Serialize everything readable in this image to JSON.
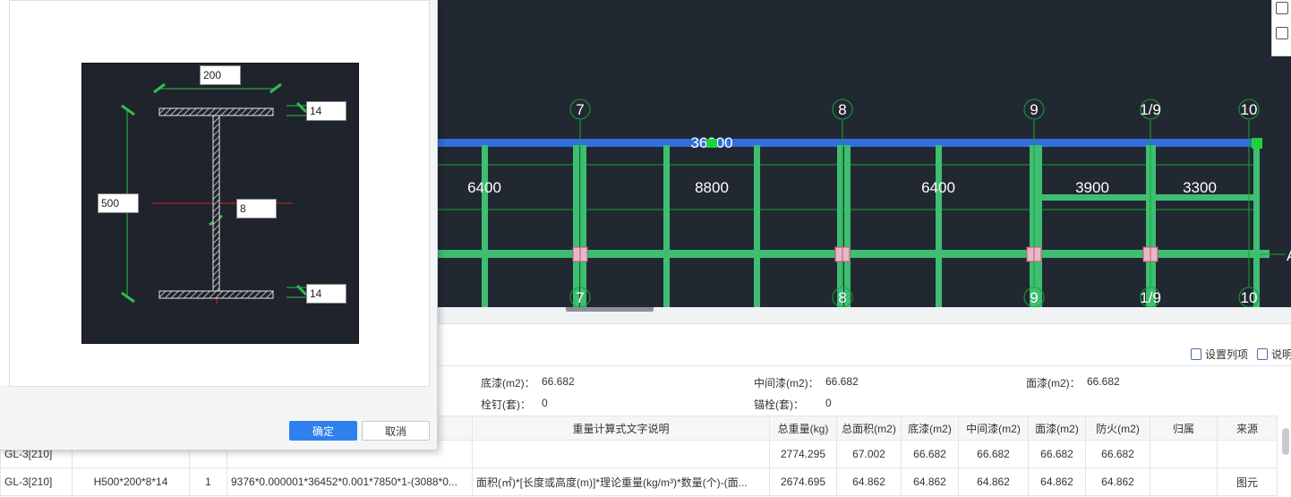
{
  "cad_view": {
    "top_axis_labels": [
      "7",
      "8",
      "9",
      "1/9",
      "10"
    ],
    "bottom_axis_labels": [
      "7",
      "8",
      "9",
      "1/9",
      "10"
    ],
    "row_axis_label": "A",
    "overall_dimension": "36000",
    "span_dimensions": [
      "6400",
      "8800",
      "6400",
      "3900",
      "3300"
    ],
    "colors": {
      "background": "#222831",
      "beam": "#3dbe73",
      "top_beam": "#2f6fe0",
      "axis": "#17a32e",
      "marker": "#e8b7c8"
    }
  },
  "section_dialog": {
    "dimensions": {
      "flange_width": "200",
      "height": "500",
      "top_flange_thickness": "14",
      "web_thickness": "8",
      "bottom_flange_thickness": "14"
    },
    "ok_label": "确定",
    "cancel_label": "取消"
  },
  "toolbar": {
    "set_columns_label": "设置列项",
    "help_label": "说明"
  },
  "summary": {
    "primer_label": "底漆(m2)：",
    "primer_value": "66.682",
    "intermediate_label": "中间漆(m2)：",
    "intermediate_value": "66.682",
    "topcoat_label": "面漆(m2)：",
    "topcoat_value": "66.682",
    "studs_label": "栓钉(套)：",
    "studs_value": "0",
    "anchor_label": "锚栓(套)：",
    "anchor_value": "0"
  },
  "table": {
    "columns": [
      "",
      "",
      "",
      "",
      "重量计算式文字说明",
      "总重量(kg)",
      "总面积(m2)",
      "底漆(m2)",
      "中间漆(m2)",
      "面漆(m2)",
      "防火(m2)",
      "归属",
      "来源"
    ],
    "rows": [
      [
        "GL-3[210]",
        "",
        "",
        "",
        "",
        "2774.295",
        "67.002",
        "66.682",
        "66.682",
        "66.682",
        "66.682",
        "",
        ""
      ],
      [
        "GL-3[210]",
        "H500*200*8*14",
        "1",
        "9376*0.000001*36452*0.001*7850*1-(3088*0...",
        "面积(㎡)*[长度或高度(m)]*理论重量(kg/m³)*数量(个)-(面...",
        "2674.695",
        "64.862",
        "64.862",
        "64.862",
        "64.862",
        "64.862",
        "",
        "图元"
      ]
    ]
  }
}
